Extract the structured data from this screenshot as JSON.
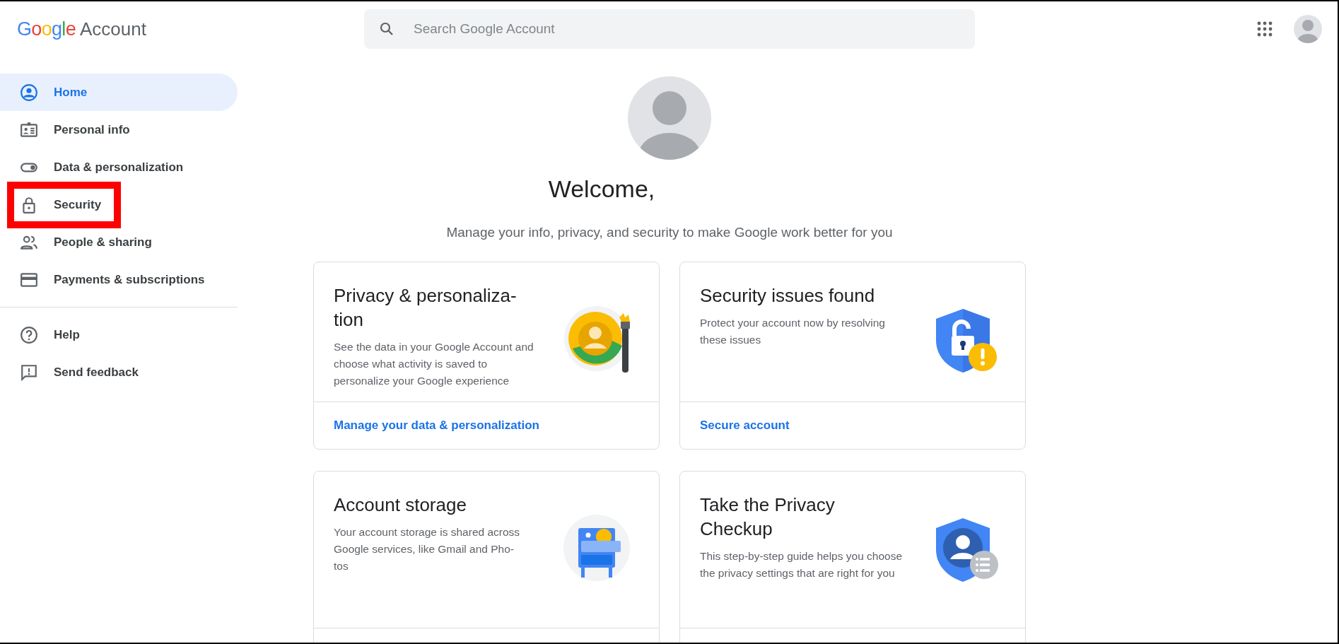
{
  "header": {
    "logo": {
      "letters": [
        {
          "char": "G",
          "color": "#4285f4"
        },
        {
          "char": "o",
          "color": "#ea4335"
        },
        {
          "char": "o",
          "color": "#fbbc05"
        },
        {
          "char": "g",
          "color": "#4285f4"
        },
        {
          "char": "l",
          "color": "#34a853"
        },
        {
          "char": "e",
          "color": "#ea4335"
        }
      ],
      "label": "Account"
    },
    "search": {
      "placeholder": "Search Google Account"
    }
  },
  "sidebar": {
    "items": [
      {
        "kind": "home",
        "label": "Home",
        "selected": true,
        "highlighted": false
      },
      {
        "kind": "personal",
        "label": "Personal info",
        "selected": false,
        "highlighted": false
      },
      {
        "kind": "data",
        "label": "Data & personalization",
        "selected": false,
        "highlighted": false
      },
      {
        "kind": "security",
        "label": "Security",
        "selected": false,
        "highlighted": true
      },
      {
        "kind": "people",
        "label": "People & sharing",
        "selected": false,
        "highlighted": false
      },
      {
        "kind": "payments",
        "label": "Payments & subscriptions",
        "selected": false,
        "highlighted": false
      }
    ],
    "footer_items": [
      {
        "kind": "help",
        "label": "Help"
      },
      {
        "kind": "feedback",
        "label": "Send feedback"
      }
    ]
  },
  "welcome": {
    "title": "Welcome,",
    "subtitle": "Manage your info, privacy, and security to make Google work better for you"
  },
  "cards": [
    {
      "kind": "privacy",
      "title": "Privacy & personaliza-\ntion",
      "body": "See the data in your Google Account and choose what activity is saved to personalize your Google experience",
      "link": "Manage your data & personalization"
    },
    {
      "kind": "security",
      "title": "Security issues found",
      "body": "Protect your account now by resolving these issues",
      "link": "Secure account"
    },
    {
      "kind": "storage",
      "title": "Account storage",
      "body": "Your account storage is shared across Google services, like Gmail and Pho-\ntos"
    },
    {
      "kind": "checkup",
      "title": "Take the Privacy\nCheckup",
      "body": "This step-by-step guide helps you choose the privacy settings that are right for you"
    }
  ]
}
